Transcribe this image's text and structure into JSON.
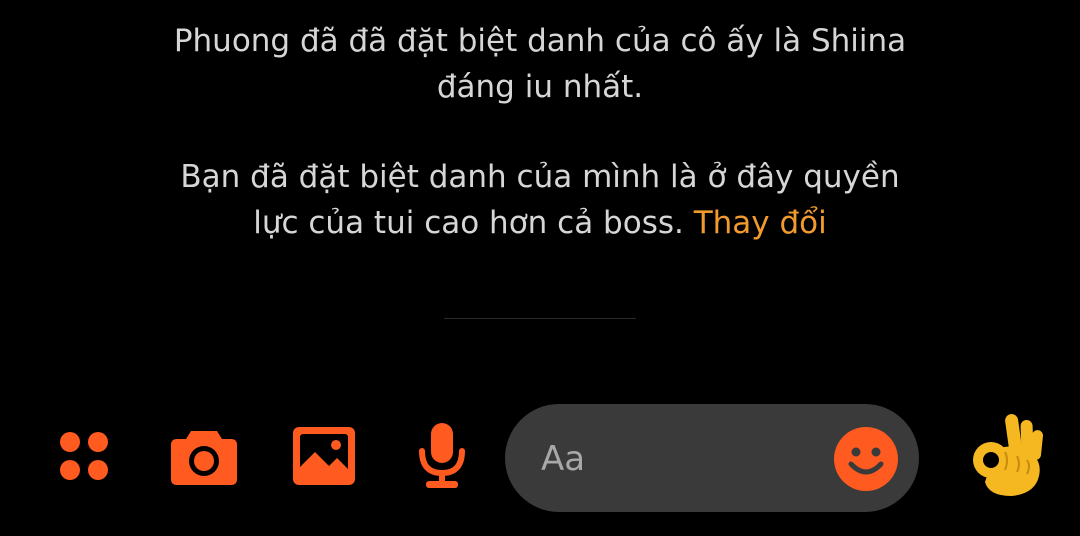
{
  "messages": [
    {
      "text": "Phuong đã đã đặt biệt danh của cô ấy là Shiina đáng iu nhất."
    },
    {
      "text": "Bạn đã đặt biệt danh của mình là ở đây quyền lực của tui cao hơn cả boss. ",
      "action_label": "Thay đổi"
    }
  ],
  "composer": {
    "input_placeholder": "Aa",
    "input_value": "",
    "icons": {
      "more": "grid-dots-icon",
      "camera": "camera-icon",
      "gallery": "image-icon",
      "voice": "microphone-icon",
      "emoji": "smiley-icon",
      "quick_reaction": "ok-hand-emoji"
    }
  },
  "colors": {
    "background": "#000000",
    "accent": "#ff5a1f",
    "link": "#f29a2e",
    "input_bg": "#3a3a3a",
    "text": "#d6d6d6"
  }
}
